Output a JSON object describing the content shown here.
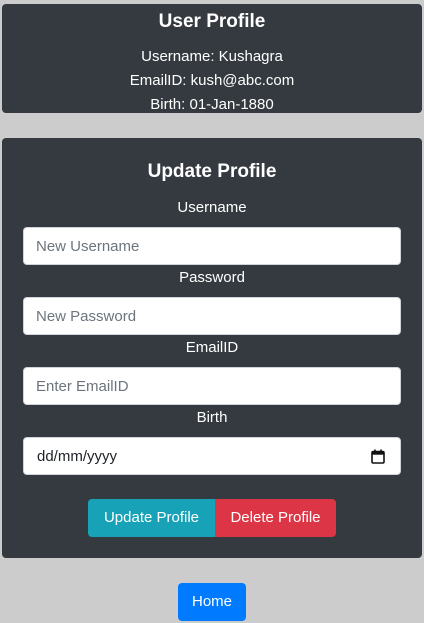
{
  "profile": {
    "title": "User Profile",
    "username_line": "Username: Kushagra",
    "email_line": "EmailID: kush@abc.com",
    "birth_line": "Birth: 01-Jan-1880"
  },
  "update_form": {
    "title": "Update Profile",
    "username": {
      "label": "Username",
      "placeholder": "New Username",
      "value": ""
    },
    "password": {
      "label": "Password",
      "placeholder": "New Password",
      "value": ""
    },
    "email": {
      "label": "EmailID",
      "placeholder": "Enter EmailID",
      "value": ""
    },
    "birth": {
      "label": "Birth",
      "placeholder": "dd/mm/yyyy",
      "icon": "calendar-icon"
    },
    "update_button_label": "Update Profile",
    "delete_button_label": "Delete Profile"
  },
  "home_button_label": "Home",
  "colors": {
    "page_background": "#cdcccd",
    "card_background": "#343a40",
    "update_button": "#17a2b8",
    "delete_button": "#dc3545",
    "home_button": "#007bff"
  }
}
